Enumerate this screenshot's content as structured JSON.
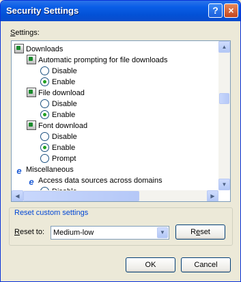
{
  "window": {
    "title": "Security Settings",
    "help_glyph": "?",
    "close_glyph": "×"
  },
  "settings_label": {
    "accel": "S",
    "rest": "ettings:"
  },
  "tree": [
    {
      "kind": "category",
      "icon": "settings-icon",
      "label": "Downloads"
    },
    {
      "kind": "setting",
      "icon": "settings-icon",
      "label": "Automatic prompting for file downloads"
    },
    {
      "kind": "option",
      "label": "Disable",
      "selected": false
    },
    {
      "kind": "option",
      "label": "Enable",
      "selected": true
    },
    {
      "kind": "setting",
      "icon": "settings-icon",
      "label": "File download"
    },
    {
      "kind": "option",
      "label": "Disable",
      "selected": false
    },
    {
      "kind": "option",
      "label": "Enable",
      "selected": true
    },
    {
      "kind": "setting",
      "icon": "settings-icon",
      "label": "Font download"
    },
    {
      "kind": "option",
      "label": "Disable",
      "selected": false
    },
    {
      "kind": "option",
      "label": "Enable",
      "selected": true
    },
    {
      "kind": "option",
      "label": "Prompt",
      "selected": false
    },
    {
      "kind": "category",
      "icon": "ie-icon",
      "label": "Miscellaneous"
    },
    {
      "kind": "setting",
      "icon": "ie-icon",
      "label": "Access data sources across domains"
    },
    {
      "kind": "option",
      "label": "Disable",
      "selected": false
    }
  ],
  "reset_group": {
    "title": "Reset custom settings",
    "reset_to": {
      "before": "",
      "accel": "R",
      "after": "eset to:"
    },
    "combo_value": "Medium-low",
    "reset_button": {
      "before": "R",
      "accel": "e",
      "after": "set"
    }
  },
  "ok_label": "OK",
  "cancel_label": "Cancel"
}
